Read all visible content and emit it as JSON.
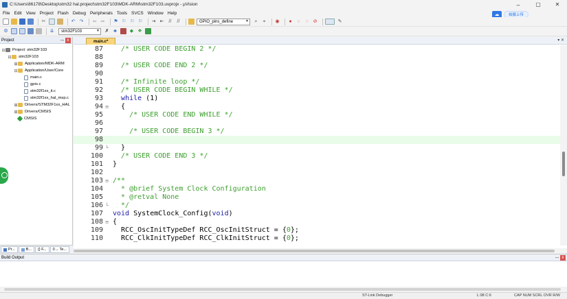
{
  "window": {
    "title": "C:\\Users\\86178\\Desktop\\stm32 hal.project\\stm32F103\\MDK-ARM\\stm32F103.uvprojx - µVision",
    "minimize": "–",
    "maximize": "▢",
    "close": "✕"
  },
  "menu": [
    "File",
    "Edit",
    "View",
    "Project",
    "Flash",
    "Debug",
    "Peripherals",
    "Tools",
    "SVCS",
    "Window",
    "Help"
  ],
  "cloud": {
    "label": "拍摄上传"
  },
  "toolbar": {
    "find_combo": "GPIO_pins_define",
    "target_combo": "stm32F103"
  },
  "project_panel": {
    "title": "Project",
    "pin": "ꟷ",
    "close": "x",
    "tree": [
      {
        "label": "Project: stm32F103",
        "level": 0,
        "exp": "⊟",
        "kind": "proj"
      },
      {
        "label": "stm32F103",
        "level": 1,
        "exp": "⊟",
        "kind": "folder"
      },
      {
        "label": "Application/MDK-ARM",
        "level": 2,
        "exp": "⊞",
        "kind": "folder"
      },
      {
        "label": "Application/User/Core",
        "level": 2,
        "exp": "⊟",
        "kind": "folder"
      },
      {
        "label": "main.c",
        "level": 3,
        "exp": "",
        "kind": "file"
      },
      {
        "label": "gpio.c",
        "level": 3,
        "exp": "",
        "kind": "file"
      },
      {
        "label": "stm32f1xx_it.c",
        "level": 3,
        "exp": "",
        "kind": "file"
      },
      {
        "label": "stm32f1xx_hal_msp.c",
        "level": 3,
        "exp": "",
        "kind": "file"
      },
      {
        "label": "Drivers/STM32F1xx_HAL",
        "level": 2,
        "exp": "⊞",
        "kind": "folder"
      },
      {
        "label": "Drivers/CMSIS",
        "level": 2,
        "exp": "⊞",
        "kind": "folder"
      },
      {
        "label": "CMSIS",
        "level": 2,
        "exp": "",
        "kind": "diamond"
      }
    ],
    "tabs": [
      "Pr...",
      "B...",
      "{} F...",
      "0→ Te..."
    ]
  },
  "editor": {
    "tab": "main.c*",
    "lines": [
      {
        "n": "87",
        "fold": "",
        "segs": [
          {
            "t": "  /* USER CODE BEGIN 2 */",
            "c": "cm"
          }
        ]
      },
      {
        "n": "88",
        "fold": "",
        "segs": []
      },
      {
        "n": "89",
        "fold": "",
        "segs": [
          {
            "t": "  /* USER CODE END 2 */",
            "c": "cm"
          }
        ]
      },
      {
        "n": "90",
        "fold": "",
        "segs": []
      },
      {
        "n": "91",
        "fold": "",
        "segs": [
          {
            "t": "  /* Infinite loop */",
            "c": "cm"
          }
        ]
      },
      {
        "n": "92",
        "fold": "",
        "segs": [
          {
            "t": "  /* USER CODE BEGIN WHILE */",
            "c": "cm"
          }
        ]
      },
      {
        "n": "93",
        "fold": "",
        "segs": [
          {
            "t": "  ",
            "c": ""
          },
          {
            "t": "while",
            "c": "kw"
          },
          {
            "t": " (1)",
            "c": ""
          }
        ]
      },
      {
        "n": "94",
        "fold": "⊟",
        "segs": [
          {
            "t": "  {",
            "c": ""
          }
        ]
      },
      {
        "n": "95",
        "fold": "",
        "segs": [
          {
            "t": "    /* USER CODE END WHILE */",
            "c": "cm"
          }
        ]
      },
      {
        "n": "96",
        "fold": "",
        "segs": []
      },
      {
        "n": "97",
        "fold": "",
        "segs": [
          {
            "t": "    /* USER CODE BEGIN 3 */",
            "c": "cm"
          }
        ]
      },
      {
        "n": "98",
        "fold": "",
        "segs": [],
        "hl": true
      },
      {
        "n": "99",
        "fold": "└",
        "segs": [
          {
            "t": "  }",
            "c": ""
          }
        ]
      },
      {
        "n": "100",
        "fold": "",
        "segs": [
          {
            "t": "  /* USER CODE END 3 */",
            "c": "cm"
          }
        ]
      },
      {
        "n": "101",
        "fold": "",
        "segs": [
          {
            "t": "}",
            "c": ""
          }
        ]
      },
      {
        "n": "102",
        "fold": "",
        "segs": []
      },
      {
        "n": "103",
        "fold": "⊟",
        "segs": [
          {
            "t": "/**",
            "c": "cm"
          }
        ]
      },
      {
        "n": "104",
        "fold": "",
        "segs": [
          {
            "t": "  * @brief System Clock Configuration",
            "c": "cm"
          }
        ]
      },
      {
        "n": "105",
        "fold": "",
        "segs": [
          {
            "t": "  * @retval None",
            "c": "cm"
          }
        ]
      },
      {
        "n": "106",
        "fold": "└",
        "segs": [
          {
            "t": "  */",
            "c": "cm"
          }
        ]
      },
      {
        "n": "107",
        "fold": "",
        "segs": [
          {
            "t": "void",
            "c": "kw"
          },
          {
            "t": " SystemClock_Config(",
            "c": ""
          },
          {
            "t": "void",
            "c": "kw"
          },
          {
            "t": ")",
            "c": ""
          }
        ]
      },
      {
        "n": "108",
        "fold": "⊟",
        "segs": [
          {
            "t": "{",
            "c": ""
          }
        ]
      },
      {
        "n": "109",
        "fold": "",
        "segs": [
          {
            "t": "  RCC_OscInitTypeDef RCC_OscInitStruct = {",
            "c": ""
          },
          {
            "t": "0",
            "c": "cm"
          },
          {
            "t": "};",
            "c": ""
          }
        ]
      },
      {
        "n": "110",
        "fold": "",
        "segs": [
          {
            "t": "  RCC_ClkInitTypeDef RCC_ClkInitStruct = {",
            "c": ""
          },
          {
            "t": "0",
            "c": "cm"
          },
          {
            "t": "};",
            "c": ""
          }
        ]
      }
    ]
  },
  "build_output": {
    "title": "Build Output"
  },
  "statusbar": {
    "debugger": "ST-Link Debugger",
    "position": "L:98 C:6",
    "flags": "CAP  NUM  SCRL  OVR  R/W"
  }
}
